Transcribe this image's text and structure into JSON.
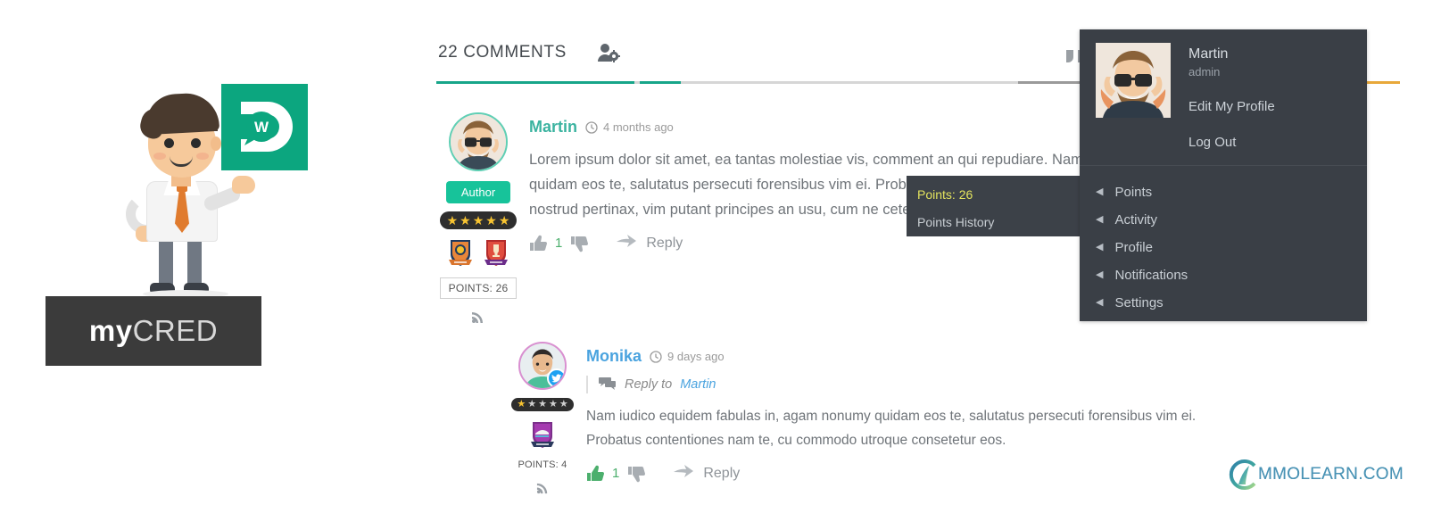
{
  "promo": {
    "wpdiscuz_logo_alt": "wpdiscuz-logo",
    "mycred": {
      "part1": "my",
      "part2": "CRED"
    }
  },
  "comments_panel": {
    "tab_title": "22 COMMENTS",
    "tabs": [
      {
        "name": "comments-tab",
        "label": "22 COMMENTS"
      },
      {
        "name": "user-settings-tab",
        "icon": "user-gear-icon"
      },
      {
        "name": "quote-tab",
        "icon": "quote-icon"
      },
      {
        "name": "bolt-tab",
        "icon": "lightning-bolt-icon"
      }
    ],
    "comments": [
      {
        "author": "Martin",
        "time": "4 months ago",
        "badge_label": "Author",
        "stars_filled": 5,
        "stars_total": 5,
        "ranks": [
          "lion-shield-badge",
          "trophy-shield-badge"
        ],
        "points_label": "POINTS: 26",
        "text": "Lorem ipsum dolor sit amet, ea tantas molestiae vis, comment an qui repudiare. Nam iudico equidem fabulas in, agam nonumy quidam eos te, salutatus persecuti forensibus vim ei. Probatus contentiones nam te, cu commodo utroque consetetur eos. Sit ne nostrud pertinax, vim putant principes an usu, cum ne ceteros eleifend sententiae, vis commune democritum neglegentur ad.",
        "vote_count": "1",
        "reply_label": "Reply"
      },
      {
        "author": "Monika",
        "time": "9 days ago",
        "reply_to_prefix": "Reply to",
        "reply_to_name": "Martin",
        "social_badge": "twitter-icon",
        "stars_filled": 1,
        "stars_total": 5,
        "ranks": [
          "sneaker-shield-badge"
        ],
        "points_label": "POINTS: 4",
        "text": "Nam iudico equidem fabulas in, agam nonumy quidam eos te, salutatus persecuti forensibus vim ei. Probatus contentiones nam te, cu commodo utroque consetetur eos.",
        "vote_count": "1",
        "reply_label": "Reply"
      }
    ]
  },
  "points_menu": {
    "points": "Points: 26",
    "history": "Points History"
  },
  "user_menu": {
    "name": "Martin",
    "role": "admin",
    "edit_profile": "Edit My Profile",
    "log_out": "Log Out",
    "items": [
      {
        "label": "Points"
      },
      {
        "label": "Activity"
      },
      {
        "label": "Profile"
      },
      {
        "label": "Notifications"
      },
      {
        "label": "Settings"
      }
    ]
  },
  "watermark": {
    "text": "MMOLEARN.COM"
  },
  "colors": {
    "teal": "#17a589",
    "author_pill": "#17c39a",
    "author_name": "#3bb3a0",
    "reply_name": "#4aa3df",
    "menu_bg": "#3a3f46",
    "submenu_bg": "#3c4148",
    "points_gold": "#e3e35e",
    "star": "#f7c331",
    "bolt": "#f0a92e",
    "vote_green": "#4caf6d",
    "mycred_bg": "#3b3b3b",
    "wpdiscuz_green": "#0ca67f"
  }
}
